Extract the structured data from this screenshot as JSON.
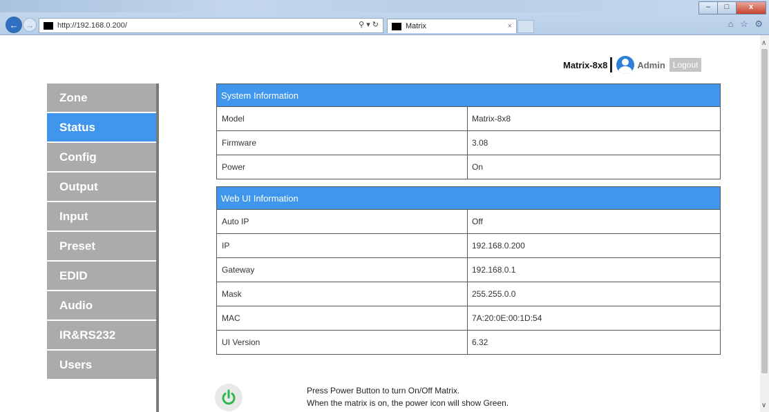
{
  "browser": {
    "url": "http://192.168.0.200/",
    "tab_title": "Matrix",
    "tab_close": "×",
    "win_min": "–",
    "win_max": "□",
    "win_close": "x",
    "addr_tools": "⚲ ▾ ↻",
    "tool_icons": "⌂ ☆ ⚙"
  },
  "header": {
    "device_name": "Matrix-8x8",
    "user": "Admin",
    "logout_label": "Logout"
  },
  "sidebar": {
    "items": [
      {
        "label": "Zone"
      },
      {
        "label": "Status"
      },
      {
        "label": "Config"
      },
      {
        "label": "Output"
      },
      {
        "label": "Input"
      },
      {
        "label": "Preset"
      },
      {
        "label": "EDID"
      },
      {
        "label": "Audio"
      },
      {
        "label": "IR&RS232"
      },
      {
        "label": "Users"
      }
    ],
    "active": "Status"
  },
  "system_info": {
    "title": "System Information",
    "rows": [
      {
        "key": "Model",
        "value": "Matrix-8x8"
      },
      {
        "key": "Firmware",
        "value": "3.08"
      },
      {
        "key": "Power",
        "value": "On"
      }
    ]
  },
  "webui_info": {
    "title": "Web UI Information",
    "rows": [
      {
        "key": "Auto IP",
        "value": "Off"
      },
      {
        "key": "IP",
        "value": "192.168.0.200"
      },
      {
        "key": "Gateway",
        "value": "192.168.0.1"
      },
      {
        "key": "Mask",
        "value": "255.255.0.0"
      },
      {
        "key": "MAC",
        "value": "7A:20:0E:00:1D:54"
      },
      {
        "key": "UI Version",
        "value": "6.32"
      }
    ]
  },
  "power_note": {
    "line1": "Press Power Button to turn On/Off Matrix.",
    "line2": "When the matrix is on, the power icon will show Green."
  },
  "colors": {
    "accent": "#3f96ec",
    "sidebar": "#ababab",
    "power_on": "#2db84a"
  }
}
